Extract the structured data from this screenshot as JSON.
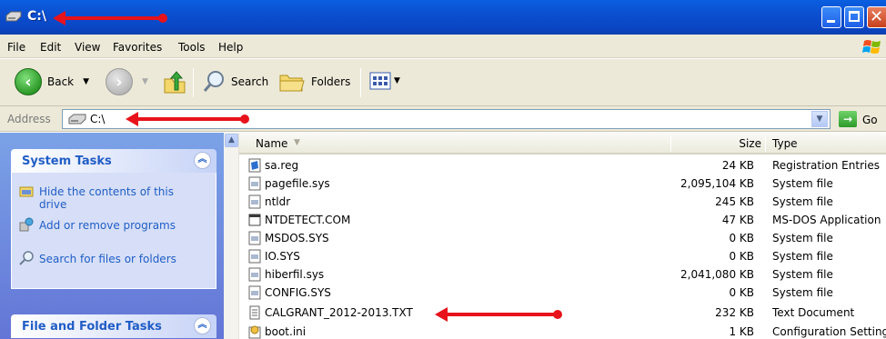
{
  "window": {
    "title": "C:\\",
    "icon": "drive-icon"
  },
  "menu": [
    "File",
    "Edit",
    "View",
    "Favorites",
    "Tools",
    "Help"
  ],
  "toolbar": {
    "back": "Back",
    "search": "Search",
    "folders": "Folders"
  },
  "address": {
    "label": "Address",
    "value": "C:\\",
    "go": "Go"
  },
  "tasks": {
    "system_title": "System Tasks",
    "system_items": [
      "Hide the contents of this drive",
      "Add or remove programs",
      "Search for files or folders"
    ],
    "file_title": "File and Folder Tasks"
  },
  "list": {
    "columns": {
      "name": "Name",
      "size": "Size",
      "type": "Type"
    },
    "rows": [
      {
        "name": "sa.reg",
        "size": "24 KB",
        "type": "Registration Entries",
        "icon": "reg-icon"
      },
      {
        "name": "pagefile.sys",
        "size": "2,095,104 KB",
        "type": "System file",
        "icon": "sys-icon"
      },
      {
        "name": "ntldr",
        "size": "245 KB",
        "type": "System file",
        "icon": "sys-icon"
      },
      {
        "name": "NTDETECT.COM",
        "size": "47 KB",
        "type": "MS-DOS Application",
        "icon": "com-icon"
      },
      {
        "name": "MSDOS.SYS",
        "size": "0 KB",
        "type": "System file",
        "icon": "sys-icon"
      },
      {
        "name": "IO.SYS",
        "size": "0 KB",
        "type": "System file",
        "icon": "sys-icon"
      },
      {
        "name": "hiberfil.sys",
        "size": "2,041,080 KB",
        "type": "System file",
        "icon": "sys-icon"
      },
      {
        "name": "CONFIG.SYS",
        "size": "0 KB",
        "type": "System file",
        "icon": "sys-icon"
      },
      {
        "name": "CALGRANT_2012-2013.TXT",
        "size": "232 KB",
        "type": "Text Document",
        "icon": "txt-icon"
      },
      {
        "name": "boot.ini",
        "size": "1 KB",
        "type": "Configuration Settings",
        "icon": "ini-icon"
      }
    ]
  },
  "colors": {
    "title_bar": "#0a46c4",
    "task_link": "#215dc6",
    "annotation_arrow": "#e8121a"
  }
}
